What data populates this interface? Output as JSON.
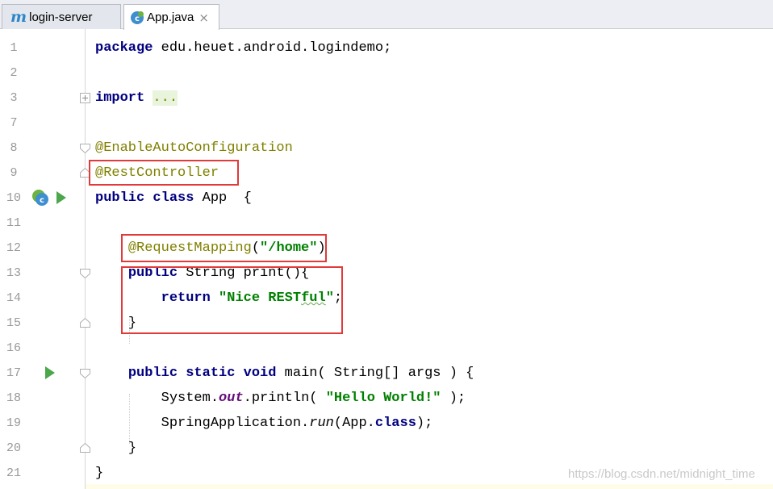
{
  "tabs": [
    {
      "label": "login-server",
      "icon": "maven-icon",
      "icon_glyph": "m",
      "active": false
    },
    {
      "label": "App.java",
      "icon": "spring-java-class-icon",
      "close_glyph": "×",
      "active": true
    }
  ],
  "editor": {
    "line_numbers": [
      "1",
      "2",
      "3",
      "7",
      "8",
      "9",
      "10",
      "11",
      "12",
      "13",
      "14",
      "15",
      "16",
      "17",
      "18",
      "19",
      "20",
      "21"
    ],
    "lines": {
      "l1": {
        "kw": "package",
        "rest": " edu.heuet.android.logindemo;"
      },
      "l3": {
        "kw": "import",
        "dots": "..."
      },
      "l8": {
        "ann": "@EnableAutoConfiguration"
      },
      "l9": {
        "ann": "@RestController"
      },
      "l10": {
        "kw1": "public",
        "kw2": "class",
        "rest": " App  {"
      },
      "l12": {
        "ann": "@RequestMapping",
        "p1": "(",
        "str": "\"/home\"",
        "p2": ")"
      },
      "l13": {
        "kw": "public",
        "rest": " String print(){"
      },
      "l14": {
        "kw": "return",
        "sp": " ",
        "str1": "\"Nice REST",
        "str_typo": "ful",
        "str2": "\"",
        "end": ";"
      },
      "l15": {
        "text": "}"
      },
      "l17": {
        "kw1": "public",
        "kw2": "static",
        "kw3": "void",
        "rest": " main( String[] args ) {"
      },
      "l18": {
        "pre": "System.",
        "field": "out",
        "mid": ".println( ",
        "str": "\"Hello World!\"",
        "end": " );"
      },
      "l19": {
        "pre": "SpringApplication.",
        "method": "run",
        "mid": "(App.",
        "kw": "class",
        "end": ");"
      },
      "l20": {
        "text": "}"
      },
      "l21": {
        "text": "}"
      }
    }
  },
  "watermark": "https://blog.csdn.net/midnight_time",
  "colors": {
    "keyword": "#000080",
    "annotation": "#808000",
    "string": "#008000",
    "highlight_box": "#e03a3a",
    "run_icon": "#4ca64c"
  }
}
